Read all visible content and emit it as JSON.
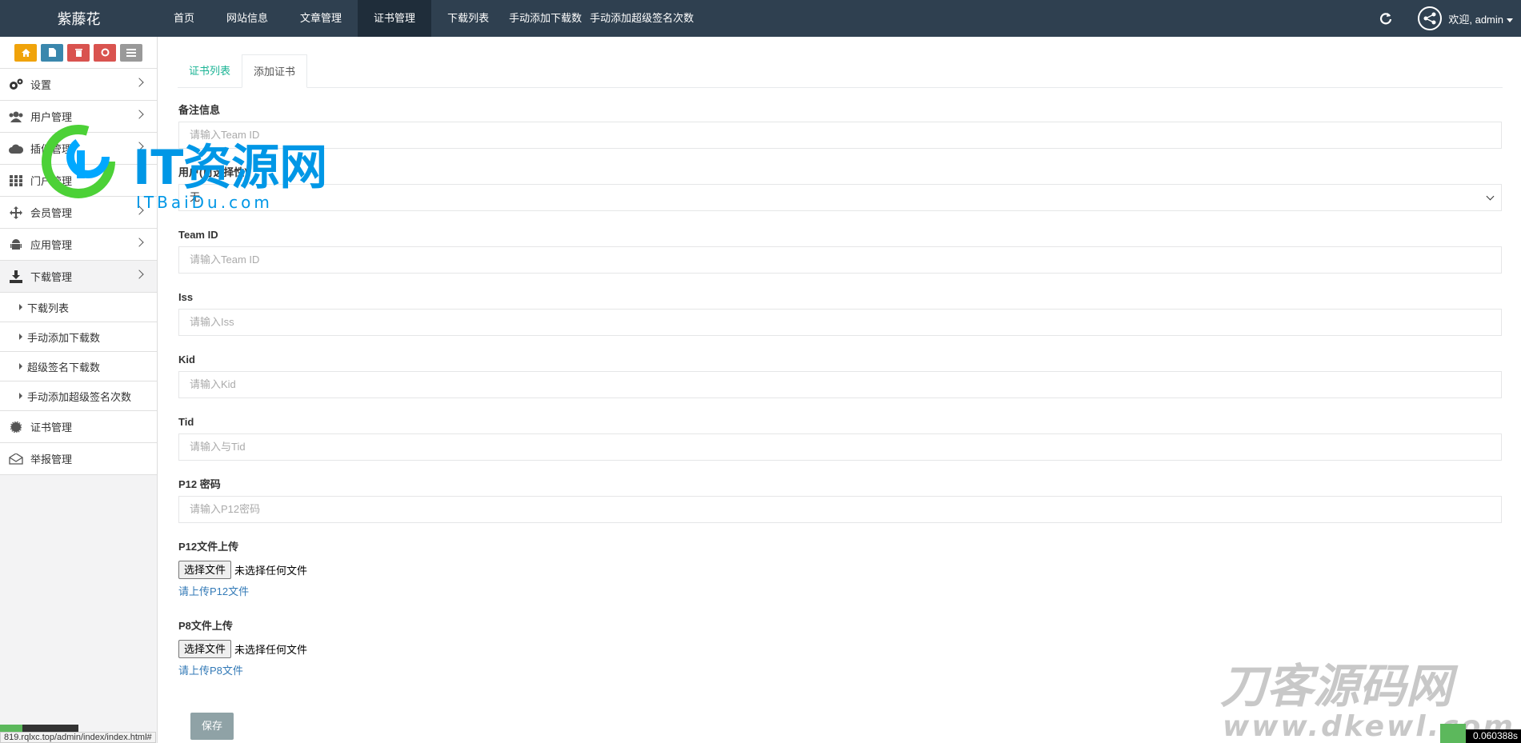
{
  "topbar": {
    "brand": "紫藤花",
    "nav": [
      {
        "label": "首页",
        "active": false
      },
      {
        "label": "网站信息",
        "active": false
      },
      {
        "label": "文章管理",
        "active": false
      },
      {
        "label": "证书管理",
        "active": true
      },
      {
        "label": "下载列表",
        "active": false
      },
      {
        "label": "手动添加下载数",
        "active": false
      },
      {
        "label": "手动添加超级签名次数",
        "active": false
      }
    ],
    "welcome": "欢迎, admin"
  },
  "sidebar": {
    "quick_buttons": [
      {
        "icon": "home-icon",
        "color": "#f0a30a"
      },
      {
        "icon": "document-icon",
        "color": "#3a87ad"
      },
      {
        "icon": "trash-icon",
        "color": "#d9534f"
      },
      {
        "icon": "recycle-icon",
        "color": "#d9534f"
      },
      {
        "icon": "list-icon",
        "color": "#999999"
      }
    ],
    "items": [
      {
        "label": "设置",
        "icon": "gears-icon"
      },
      {
        "label": "用户管理",
        "icon": "users-icon"
      },
      {
        "label": "插件管理",
        "icon": "cloud-icon"
      },
      {
        "label": "门户管理",
        "icon": "grid-icon"
      },
      {
        "label": "会员管理",
        "icon": "move-icon"
      },
      {
        "label": "应用管理",
        "icon": "android-icon"
      },
      {
        "label": "下载管理",
        "icon": "download-icon"
      }
    ],
    "sub_items": [
      {
        "label": "下载列表"
      },
      {
        "label": "手动添加下载数"
      },
      {
        "label": "超级签名下载数"
      },
      {
        "label": "手动添加超级签名次数"
      }
    ],
    "bottom_items": [
      {
        "label": "证书管理",
        "icon": "certificate-icon"
      },
      {
        "label": "举报管理",
        "icon": "envelope-icon"
      }
    ]
  },
  "tabs": [
    {
      "label": "证书列表",
      "active": false
    },
    {
      "label": "添加证书",
      "active": true
    }
  ],
  "form": {
    "remark": {
      "label": "备注信息",
      "placeholder": "请输入Team ID"
    },
    "user": {
      "label": "用户(可选择性)",
      "value": "无"
    },
    "team_id": {
      "label": "Team ID",
      "placeholder": "请输入Team ID"
    },
    "iss": {
      "label": "Iss",
      "placeholder": "请输入Iss"
    },
    "kid": {
      "label": "Kid",
      "placeholder": "请输入Kid"
    },
    "tid": {
      "label": "Tid",
      "placeholder": "请输入与Tid"
    },
    "p12_password": {
      "label": "P12 密码",
      "placeholder": "请输入P12密码"
    },
    "p12_file": {
      "label": "P12文件上传",
      "button": "选择文件",
      "status": "未选择任何文件",
      "hint": "请上传P12文件"
    },
    "p8_file": {
      "label": "P8文件上传",
      "button": "选择文件",
      "status": "未选择任何文件",
      "hint": "请上传P8文件"
    },
    "save": "保存"
  },
  "watermarks": {
    "logo_text": "IT资源网",
    "logo_sub": "ITBaiDu.com",
    "corner_text": "刀客源码网",
    "corner_sub": "www.dkewl.com"
  },
  "status": {
    "url": "819.rqlxc.top/admin/index/index.html#",
    "timer": "0.060388s"
  }
}
